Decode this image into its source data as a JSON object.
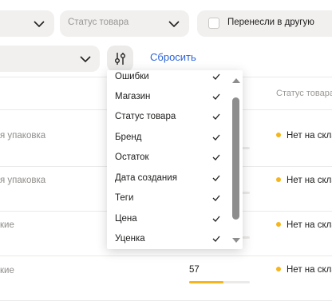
{
  "filters": {
    "status_placeholder": "Статус товара",
    "moved_label": "Перенесли в другую",
    "reset_label": "Сбросить"
  },
  "table": {
    "status_header": "Статус товара",
    "rows": [
      {
        "type": "я упаковка",
        "remain": "",
        "status": "Нет на скла"
      },
      {
        "type": "я упаковка",
        "remain": "",
        "status": "Нет на скла"
      },
      {
        "type": "кие",
        "remain": "",
        "status": "Нет на скла"
      },
      {
        "type": "кие",
        "remain": "57",
        "status": "Нет на скла"
      }
    ]
  },
  "column_menu": {
    "items": [
      {
        "label": "Ошибки",
        "checked": true
      },
      {
        "label": "Магазин",
        "checked": true
      },
      {
        "label": "Статус товара",
        "checked": true
      },
      {
        "label": "Бренд",
        "checked": true
      },
      {
        "label": "Остаток",
        "checked": true
      },
      {
        "label": "Дата создания",
        "checked": true
      },
      {
        "label": "Теги",
        "checked": true
      },
      {
        "label": "Цена",
        "checked": true
      },
      {
        "label": "Уценка",
        "checked": true
      }
    ]
  },
  "colors": {
    "accent_link": "#2d63d8",
    "status_dot": "#f5b51b",
    "pill_bg": "#f1f0ef"
  },
  "icons": {
    "dropdown": "chevron-down-icon",
    "settings": "sliders-icon",
    "check": "check-icon",
    "scroll_up": "arrow-up-icon",
    "scroll_down": "arrow-down-icon"
  }
}
